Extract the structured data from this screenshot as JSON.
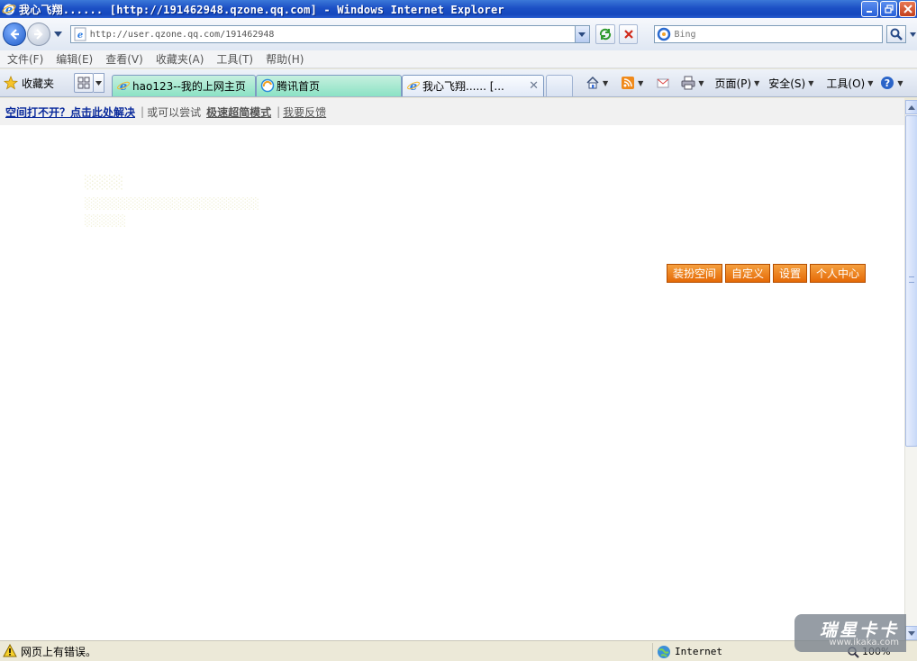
{
  "window": {
    "title": "我心飞翔...... [http://191462948.qzone.qq.com] - Windows Internet Explorer"
  },
  "address_bar": {
    "url": "http://user.qzone.qq.com/191462948"
  },
  "search": {
    "placeholder": "Bing"
  },
  "menu": {
    "items": [
      "文件(F)",
      "编辑(E)",
      "查看(V)",
      "收藏夹(A)",
      "工具(T)",
      "帮助(H)"
    ]
  },
  "favorites": {
    "label": "收藏夹"
  },
  "tabs": [
    {
      "label": "hao123--我的上网主页"
    },
    {
      "label": "腾讯首页"
    },
    {
      "label": "我心飞翔...... [..."
    }
  ],
  "command_bar": {
    "page": "页面(P)",
    "safety": "安全(S)",
    "tools": "工具(O)"
  },
  "notice_bar": {
    "main_link": "空间打不开？点击此处解决",
    "sep": "|",
    "try_text": "或可以尝试",
    "simple_mode": "极速超简模式",
    "feedback": "我要反馈"
  },
  "qzone_buttons": [
    "装扮空间",
    "自定义",
    "设置",
    "个人中心"
  ],
  "status_bar": {
    "message": "网页上有错误。",
    "zone": "Internet",
    "zoom": "100%"
  },
  "watermark": {
    "main": "瑞星卡卡",
    "sub": "www.ikaka.com"
  },
  "colors": {
    "titlebar": "#1c50c5",
    "qzone_button": "#e56a06",
    "link": "#0b2b9c",
    "tab_active_green": "#8be2c4"
  }
}
